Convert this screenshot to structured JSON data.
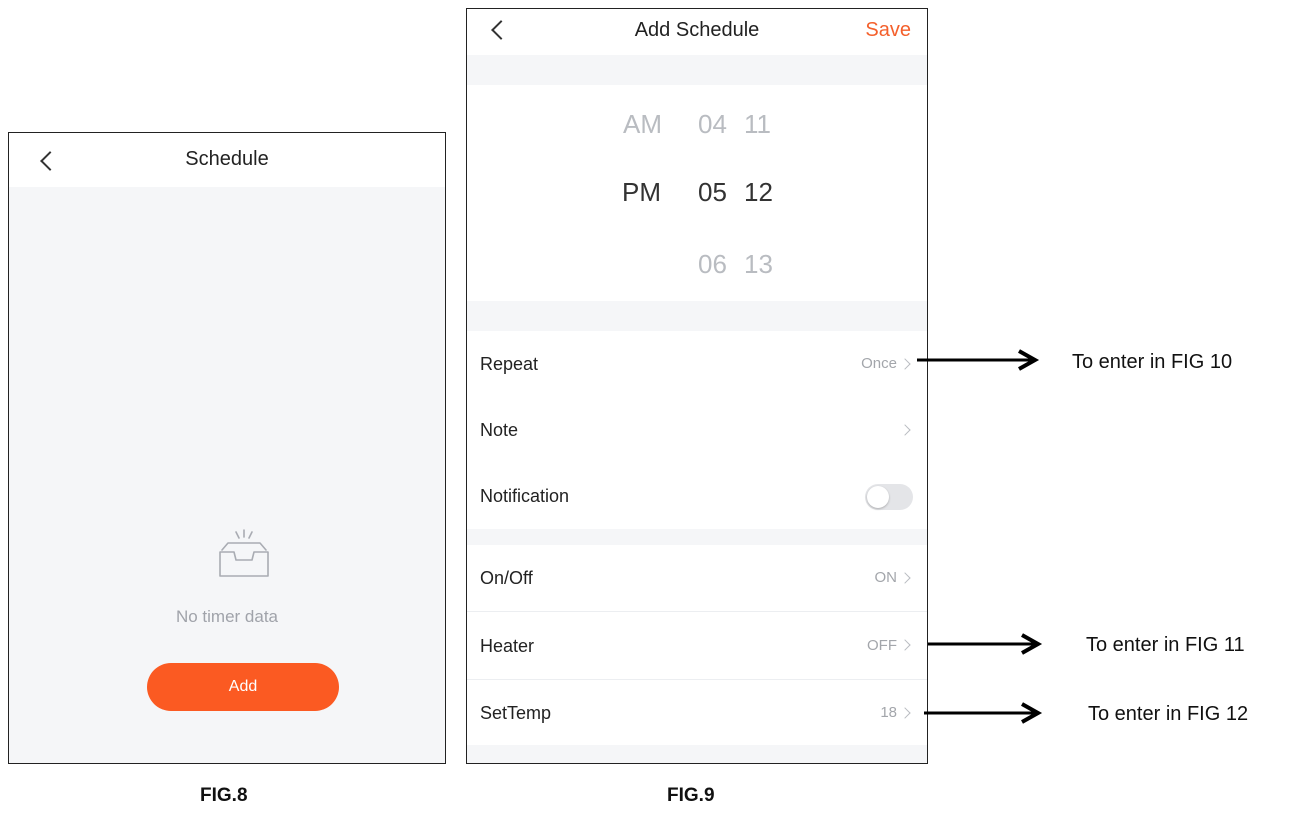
{
  "fig8": {
    "header": {
      "title": "Schedule"
    },
    "empty": {
      "icon": "empty-inbox-icon",
      "text": "No timer data"
    },
    "add_button": "Add",
    "caption": "FIG.8"
  },
  "fig9": {
    "header": {
      "title": "Add Schedule",
      "save": "Save"
    },
    "picker": {
      "ampm": [
        "AM",
        "PM"
      ],
      "hours": [
        "04",
        "05",
        "06"
      ],
      "minutes": [
        "11",
        "12",
        "13"
      ],
      "selected": {
        "ampm": "PM",
        "hour": "05",
        "minute": "12"
      }
    },
    "rows": {
      "repeat": {
        "label": "Repeat",
        "value": "Once"
      },
      "note": {
        "label": "Note",
        "value": ""
      },
      "notification": {
        "label": "Notification",
        "enabled": false
      },
      "onoff": {
        "label": "On/Off",
        "value": "ON"
      },
      "heater": {
        "label": "Heater",
        "value": "OFF"
      },
      "settemp": {
        "label": "SetTemp",
        "value": "18"
      }
    },
    "caption": "FIG.9"
  },
  "annotations": {
    "repeat": "To enter in FIG 10",
    "heater": "To enter in FIG 11",
    "settemp": "To enter in FIG 12"
  },
  "colors": {
    "accent": "#fb5a22",
    "save": "#f4602c",
    "background": "#f5f6f8"
  }
}
